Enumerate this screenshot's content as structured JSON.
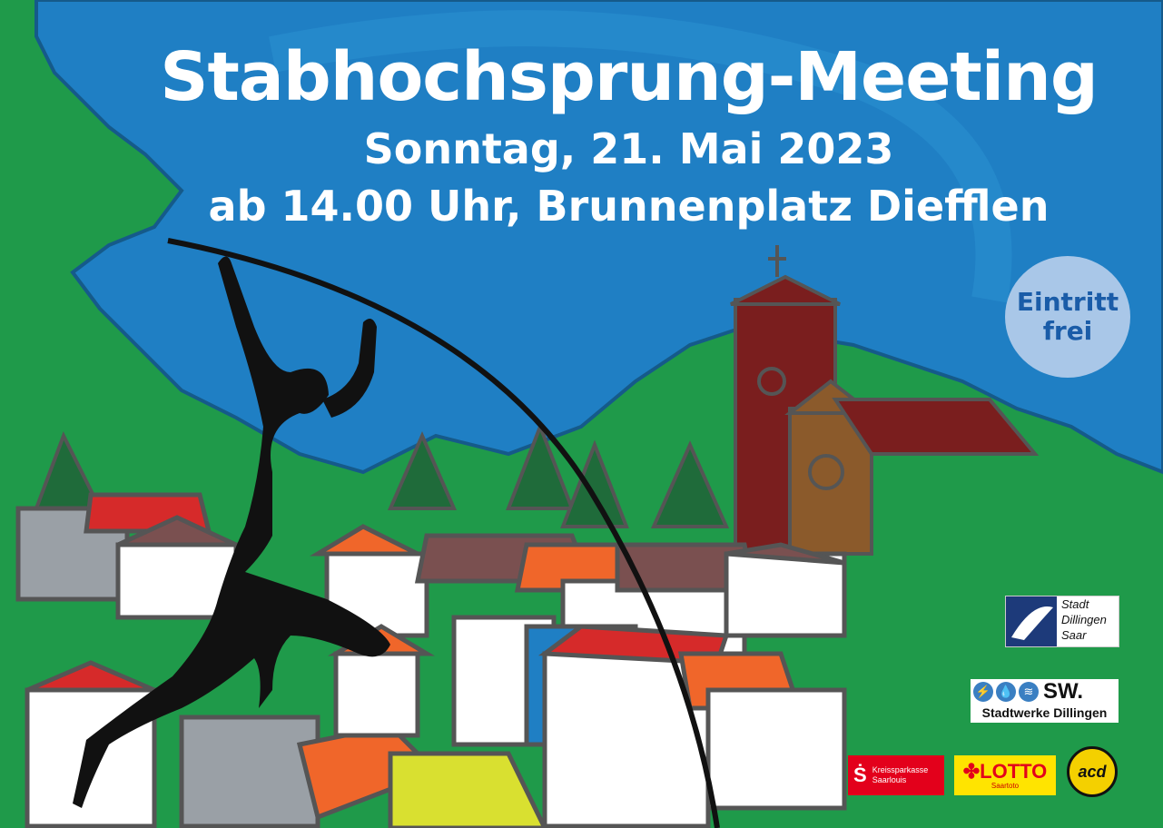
{
  "event": {
    "title": "Stabhochsprung-Meeting",
    "date": "Sonntag, 21. Mai 2023",
    "time_place": "ab 14.00 Uhr, Brunnenplatz Diefflen"
  },
  "badge": {
    "line1": "Eintritt",
    "line2": "frei"
  },
  "sponsors": {
    "dillingen": {
      "line1": "Stadt",
      "line2": "Dillingen",
      "line3": "Saar"
    },
    "stadtwerke": {
      "short": "SW.",
      "name": "Stadtwerke Dillingen"
    },
    "kreissparkasse": {
      "line1": "Kreissparkasse",
      "line2": "Saarlouis"
    },
    "lotto": {
      "name": "LOTTO",
      "sub": "Saartoto"
    },
    "acd": {
      "name": "acd"
    }
  },
  "colors": {
    "sky": "#1f7fc4",
    "grass": "#1f9a4a",
    "badge": "#a9c7e8",
    "badge_text": "#1a5ca8",
    "church": "#7a1e1e",
    "roof_red": "#d62a2a",
    "roof_orange": "#f0662a"
  }
}
